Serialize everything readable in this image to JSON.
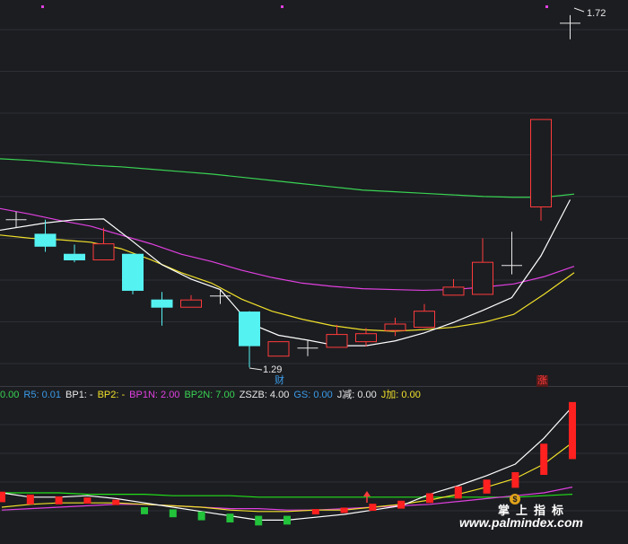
{
  "annotations": {
    "high_price": "1.72",
    "low_price": "1.29",
    "cai_marker": "财",
    "zhang_marker": "涨"
  },
  "legend": [
    {
      "text": "0.00",
      "color": "#39d353"
    },
    {
      "text": "R5: 0.01",
      "color": "#3a9be8"
    },
    {
      "text": "BP1: -",
      "color": "#e8e8e8"
    },
    {
      "text": "BP2: -",
      "color": "#f0e02a"
    },
    {
      "text": "BP1N: 2.00",
      "color": "#e040e0"
    },
    {
      "text": "BP2N: 7.00",
      "color": "#39d353"
    },
    {
      "text": "ZSZB: 4.00",
      "color": "#e8e8e8"
    },
    {
      "text": "GS: 0.00",
      "color": "#3a9be8"
    },
    {
      "text": "J减: 0.00",
      "color": "#e8e8e8"
    },
    {
      "text": "J加: 0.00",
      "color": "#f0e02a"
    }
  ],
  "watermark": {
    "cn_text": "掌上指标",
    "url_text": "www.palmindex.com",
    "logo_text": "$"
  },
  "colors": {
    "up": "#ff3b3b",
    "down": "#55f2f2",
    "ma_white": "#ffffff",
    "ma_yellow": "#f0e02a",
    "ma_magenta": "#e040e0",
    "ma_green": "#39d353",
    "grid": "#2e2f36"
  },
  "chart_data": {
    "type": "candlestick",
    "price_range": [
      1.27,
      1.74
    ],
    "candles": [
      {
        "o": 1.475,
        "h": 1.485,
        "l": 1.465,
        "c": 1.475
      },
      {
        "o": 1.457,
        "h": 1.475,
        "l": 1.435,
        "c": 1.442
      },
      {
        "o": 1.432,
        "h": 1.444,
        "l": 1.422,
        "c": 1.425
      },
      {
        "o": 1.425,
        "h": 1.465,
        "l": 1.425,
        "c": 1.445
      },
      {
        "o": 1.432,
        "h": 1.432,
        "l": 1.382,
        "c": 1.387
      },
      {
        "o": 1.375,
        "h": 1.385,
        "l": 1.343,
        "c": 1.366
      },
      {
        "o": 1.366,
        "h": 1.381,
        "l": 1.366,
        "c": 1.375
      },
      {
        "o": 1.38,
        "h": 1.388,
        "l": 1.37,
        "c": 1.38
      },
      {
        "o": 1.36,
        "h": 1.361,
        "l": 1.291,
        "c": 1.318
      },
      {
        "o": 1.305,
        "h": 1.323,
        "l": 1.305,
        "c": 1.323
      },
      {
        "o": 1.315,
        "h": 1.325,
        "l": 1.305,
        "c": 1.315
      },
      {
        "o": 1.316,
        "h": 1.344,
        "l": 1.316,
        "c": 1.332
      },
      {
        "o": 1.323,
        "h": 1.34,
        "l": 1.317,
        "c": 1.333
      },
      {
        "o": 1.337,
        "h": 1.353,
        "l": 1.33,
        "c": 1.345
      },
      {
        "o": 1.341,
        "h": 1.37,
        "l": 1.341,
        "c": 1.361
      },
      {
        "o": 1.381,
        "h": 1.401,
        "l": 1.381,
        "c": 1.391
      },
      {
        "o": 1.382,
        "h": 1.452,
        "l": 1.382,
        "c": 1.422
      },
      {
        "o": 1.418,
        "h": 1.46,
        "l": 1.407,
        "c": 1.418
      },
      {
        "o": 1.491,
        "h": 1.6,
        "l": 1.474,
        "c": 1.6
      },
      {
        "o": 1.72,
        "h": 1.73,
        "l": 1.7,
        "c": 1.72
      }
    ],
    "ma_white": [
      1.462,
      1.471,
      1.475,
      1.476,
      1.448,
      1.419,
      1.401,
      1.388,
      1.346,
      1.331,
      1.325,
      1.318,
      1.318,
      1.324,
      1.334,
      1.347,
      1.362,
      1.378,
      1.43,
      1.5
    ],
    "ma_yellow": [
      1.456,
      1.452,
      1.45,
      1.447,
      1.439,
      1.425,
      1.409,
      1.396,
      1.376,
      1.361,
      1.351,
      1.343,
      1.338,
      1.336,
      1.338,
      1.341,
      1.347,
      1.357,
      1.382,
      1.409
    ],
    "ma_magenta": [
      1.489,
      1.482,
      1.474,
      1.467,
      1.456,
      1.445,
      1.432,
      1.423,
      1.412,
      1.403,
      1.396,
      1.392,
      1.389,
      1.388,
      1.387,
      1.388,
      1.391,
      1.395,
      1.404,
      1.417
    ],
    "ma_green": [
      1.551,
      1.549,
      1.546,
      1.543,
      1.541,
      1.538,
      1.535,
      1.532,
      1.528,
      1.524,
      1.52,
      1.516,
      1.512,
      1.51,
      1.508,
      1.506,
      1.504,
      1.503,
      1.503,
      1.507
    ],
    "sub_bars": [
      -0.08,
      -0.07,
      -0.05,
      -0.03,
      -0.02,
      0.04,
      0.05,
      0.06,
      0.06,
      0.07,
      0.06,
      -0.02,
      -0.02,
      -0.04,
      -0.05,
      -0.07,
      -0.1,
      -0.12,
      -0.14,
      -0.32,
      -0.62
    ],
    "sub_white": [
      -0.05,
      -0.02,
      -0.02,
      -0.03,
      -0.01,
      0.02,
      0.05,
      0.08,
      0.11,
      0.14,
      0.14,
      0.12,
      0.1,
      0.07,
      0.04,
      -0.04,
      -0.1,
      -0.17,
      -0.25,
      -0.43,
      -0.65
    ],
    "sub_yellow": [
      0.05,
      0.03,
      0.02,
      0.02,
      0.02,
      0.03,
      0.04,
      0.05,
      0.07,
      0.08,
      0.08,
      0.07,
      0.07,
      0.05,
      0.03,
      0.0,
      -0.04,
      -0.09,
      -0.15,
      -0.25,
      -0.4
    ],
    "sub_magenta": [
      0.07,
      0.06,
      0.05,
      0.04,
      0.03,
      0.03,
      0.04,
      0.05,
      0.06,
      0.06,
      0.07,
      0.07,
      0.06,
      0.05,
      0.04,
      0.03,
      0.01,
      -0.01,
      -0.03,
      -0.05,
      -0.09
    ],
    "sub_green": [
      -0.05,
      -0.05,
      -0.05,
      -0.04,
      -0.04,
      -0.04,
      -0.03,
      -0.03,
      -0.03,
      -0.02,
      -0.02,
      -0.02,
      -0.02,
      -0.02,
      -0.02,
      -0.02,
      -0.02,
      -0.02,
      -0.02,
      -0.03,
      -0.04
    ]
  }
}
